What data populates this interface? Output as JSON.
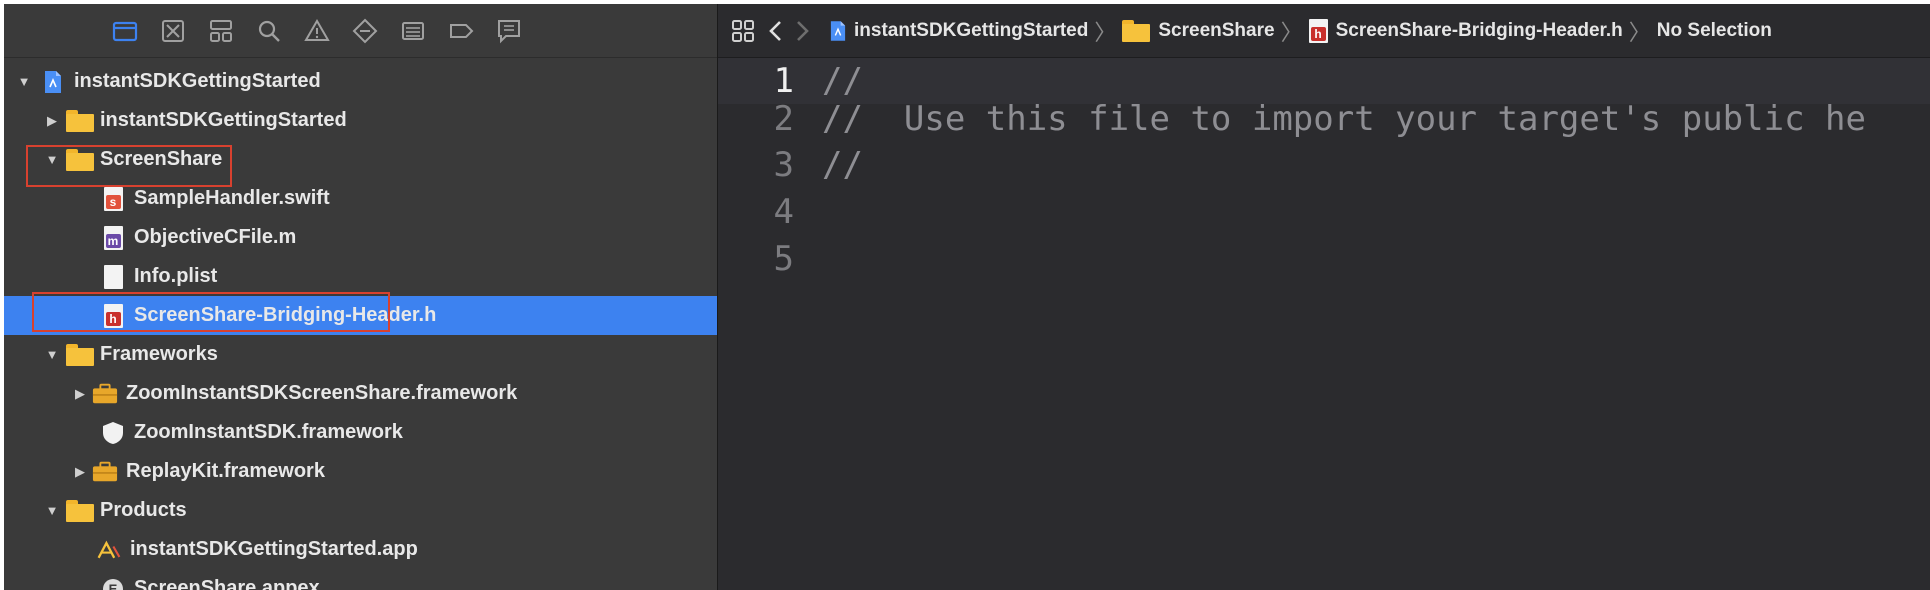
{
  "navigator": {
    "toolbar_icons": [
      "folder-icon",
      "source-control-icon",
      "symbol-icon",
      "search-icon",
      "warning-icon",
      "test-icon",
      "debug-icon",
      "breakpoint-icon",
      "report-icon"
    ],
    "tree": [
      {
        "label": "instantSDKGettingStarted",
        "icon": "project-file-icon",
        "expanded": true
      },
      {
        "label": "instantSDKGettingStarted",
        "icon": "folder-icon",
        "expanded": false
      },
      {
        "label": "ScreenShare",
        "icon": "folder-icon",
        "expanded": true
      },
      {
        "label": "SampleHandler.swift",
        "icon": "swift-file-icon",
        "badge": "s",
        "badge_color": "#e2523c"
      },
      {
        "label": "ObjectiveCFile.m",
        "icon": "objc-file-icon",
        "badge": "m",
        "badge_color": "#6b4aa8"
      },
      {
        "label": "Info.plist",
        "icon": "plist-file-icon"
      },
      {
        "label": "ScreenShare-Bridging-Header.h",
        "icon": "header-file-icon",
        "badge": "h",
        "badge_color": "#c9302c",
        "selected": true
      },
      {
        "label": "Frameworks",
        "icon": "folder-icon",
        "expanded": true
      },
      {
        "label": "ZoomInstantSDKScreenShare.framework",
        "icon": "framework-icon",
        "expanded": false
      },
      {
        "label": "ZoomInstantSDK.framework",
        "icon": "shield-framework-icon"
      },
      {
        "label": "ReplayKit.framework",
        "icon": "framework-icon",
        "expanded": false
      },
      {
        "label": "Products",
        "icon": "folder-icon",
        "expanded": true
      },
      {
        "label": "instantSDKGettingStarted.app",
        "icon": "app-icon"
      },
      {
        "label": "ScreenShare.appex",
        "icon": "appex-icon"
      }
    ],
    "accent_color": "#3d82f0",
    "highlight_color": "#d8412f"
  },
  "editor": {
    "breadcrumbs": [
      {
        "label": "instantSDKGettingStarted",
        "icon": "project-file-icon"
      },
      {
        "label": "ScreenShare",
        "icon": "folder-icon"
      },
      {
        "label": "ScreenShare-Bridging-Header.h",
        "icon": "header-file-icon",
        "badge": "h"
      },
      {
        "label": "No Selection"
      }
    ],
    "lines": [
      {
        "number": "1",
        "text": "//"
      },
      {
        "number": "2",
        "text": "//  Use this file to import your target's public he"
      },
      {
        "number": "3",
        "text": "//"
      },
      {
        "number": "4",
        "text": ""
      },
      {
        "number": "5",
        "text": ""
      }
    ]
  }
}
